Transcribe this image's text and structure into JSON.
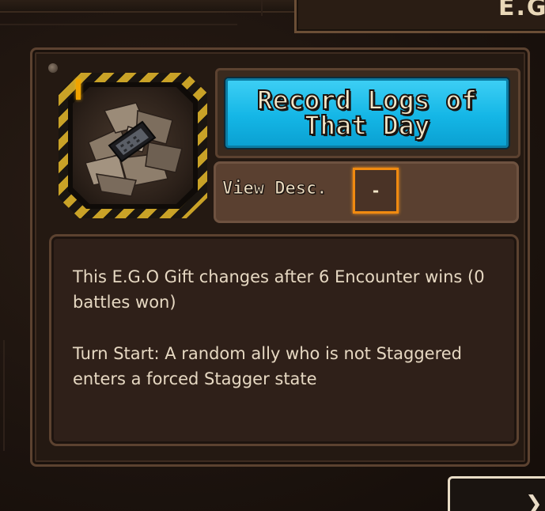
{
  "header": {
    "tab_text": "E.G"
  },
  "gift": {
    "title": "Record Logs of That Day",
    "icon": "crumpled-papers-and-phone-icon",
    "tier_color": "#f0a300",
    "accent_color": "#14b6e6"
  },
  "desc_toggle": {
    "label": "View Desc.",
    "value": "-"
  },
  "description": {
    "line1": "This E.G.O Gift changes after 6 Encounter wins (0 battles won)",
    "line2": "Turn Start: A random ally who is not Staggered enters a forced Stagger state"
  },
  "corner_button": {
    "icon": "chevron-icon"
  }
}
